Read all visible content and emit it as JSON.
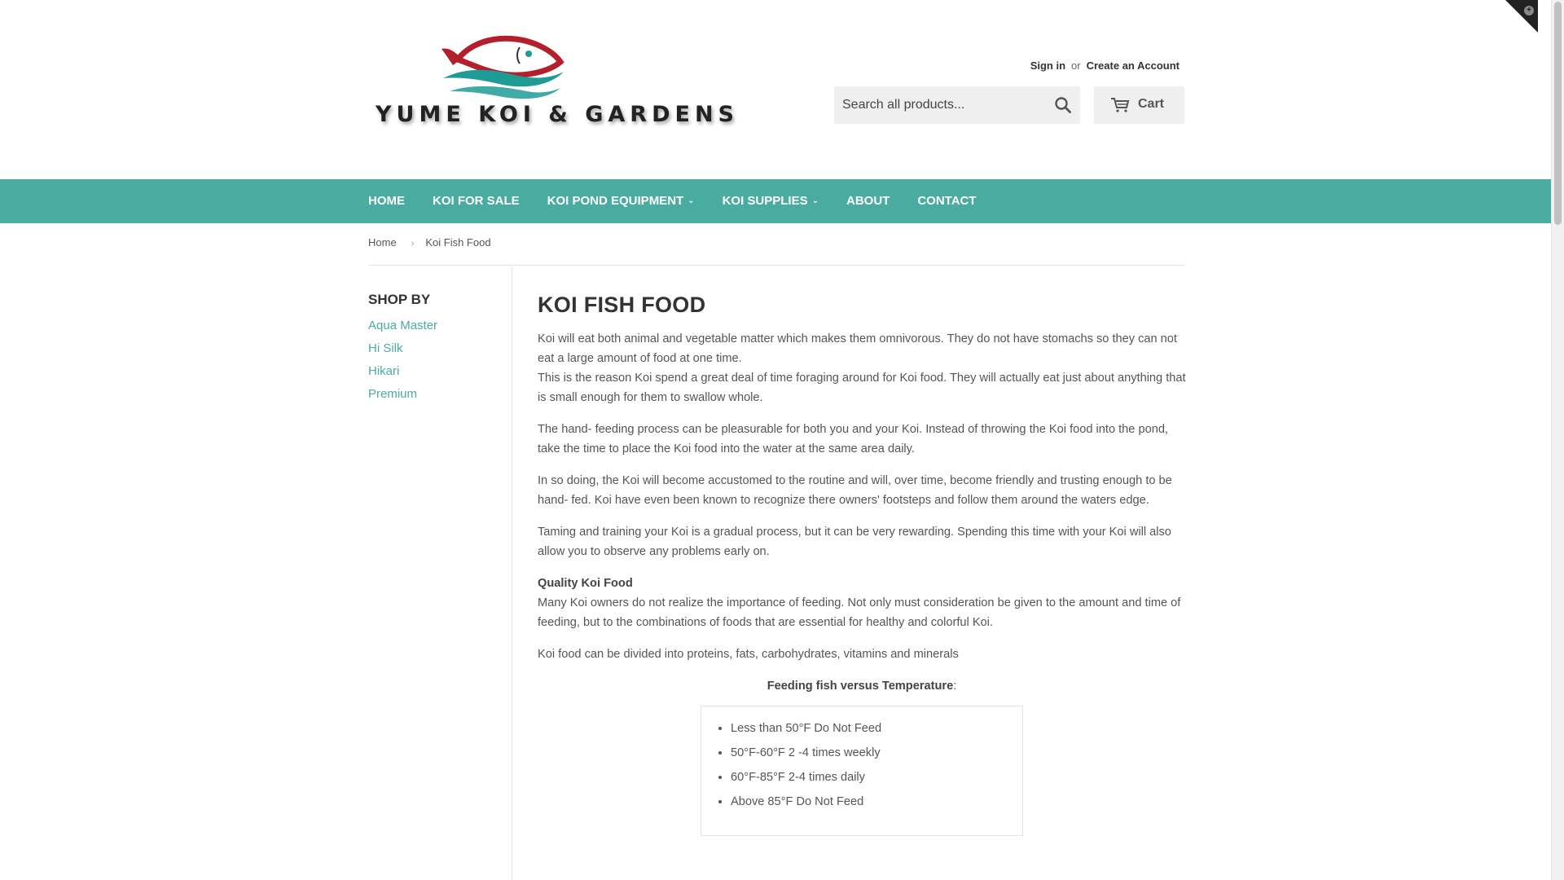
{
  "brand": {
    "name": "YUME KOI & GARDENS",
    "colors": {
      "accent": "#4aaba0",
      "logo_red": "#b3202c",
      "logo_teal": "#1f9b96"
    }
  },
  "account": {
    "sign_in": "Sign in",
    "or": "or",
    "create": "Create an Account"
  },
  "search": {
    "placeholder": "Search all products...",
    "icon": "search-icon"
  },
  "cart": {
    "label": "Cart",
    "icon": "cart-icon"
  },
  "nav": [
    {
      "label": "HOME",
      "dropdown": false
    },
    {
      "label": "KOI FOR SALE",
      "dropdown": false
    },
    {
      "label": "KOI POND EQUIPMENT",
      "dropdown": true
    },
    {
      "label": "KOI SUPPLIES",
      "dropdown": true
    },
    {
      "label": "ABOUT",
      "dropdown": false
    },
    {
      "label": "CONTACT",
      "dropdown": false
    }
  ],
  "breadcrumb": {
    "home": "Home",
    "separator": "›",
    "current": "Koi Fish Food"
  },
  "sidebar": {
    "title": "SHOP BY",
    "items": [
      "Aqua Master",
      "Hi Silk",
      "Hikari",
      "Premium"
    ]
  },
  "content": {
    "title": "KOI FISH FOOD",
    "p1a": "Koi will eat both animal and vegetable matter which makes them omnivorous. They do not have stomachs so they can not eat a large amount of food at one time.",
    "p1b": "This is the reason Koi spend a great deal of time foraging around for Koi food. They will actually eat just about anything that is small enough for them to swallow whole.",
    "p2": "The hand- feeding process can be pleasurable for both you and your Koi. Instead of throwing the Koi food into the pond, take the time to place the Koi food into the water at the same area daily.",
    "p3": "In so doing, the Koi will become accustomed to the routine and will, over time, become friendly and trusting enough to be hand- fed. Koi have even been known to recognize there owners' footsteps and follow them around the waters edge.",
    "p4": "Taming and training your Koi is a gradual process, but it can be very rewarding. Spending this time with your Koi will also allow you to observe any problems early on.",
    "quality_heading": "Quality Koi Food",
    "p5": "Many Koi owners do not realize the importance of feeding. Not only must consideration be given to the amount and time of feeding, but to the combinations of foods that are essential for healthy and colorful Koi.",
    "p6": "Koi food can be divided into proteins, fats, carbohydrates, vitamins and minerals",
    "feeding_heading": "Feeding fish versus Temperature",
    "feeding_colon": ":",
    "feeding_list": [
      "Less than 50°F Do Not Feed",
      "50°F-60°F 2 -4 times weekly",
      "60°F-85°F 2-4 times daily",
      "Above 85°F Do Not Feed"
    ]
  }
}
